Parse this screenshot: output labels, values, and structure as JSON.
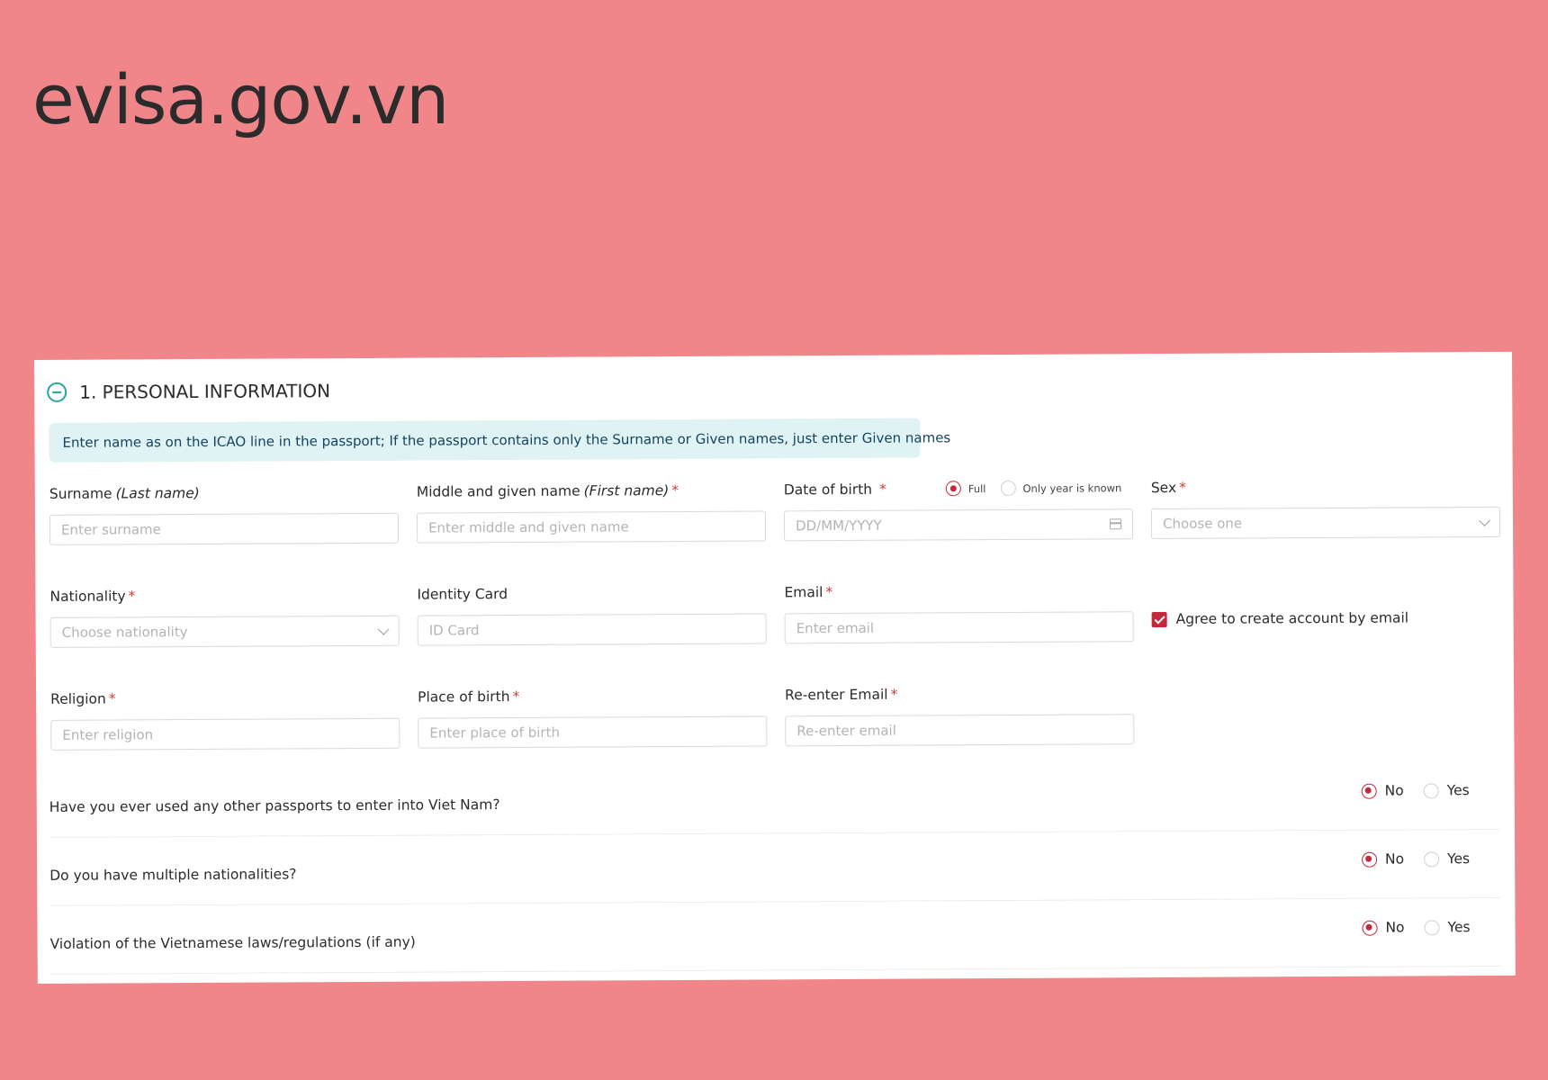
{
  "site_title": "evisa.gov.vn",
  "section": {
    "title": "1. PERSONAL INFORMATION",
    "notice": "Enter name as on the ICAO line in the passport; If the passport contains only the Surname or Given names, just enter Given names"
  },
  "fields": {
    "surname": {
      "label": "Surname",
      "label_em": "(Last name)",
      "placeholder": "Enter surname"
    },
    "given_name": {
      "label": "Middle and given name",
      "label_em": "(First name)",
      "placeholder": "Enter middle and given name"
    },
    "dob": {
      "label": "Date of birth",
      "placeholder": "DD/MM/YYYY",
      "option_full": "Full",
      "option_year": "Only year is known"
    },
    "sex": {
      "label": "Sex",
      "placeholder": "Choose one"
    },
    "nationality": {
      "label": "Nationality",
      "placeholder": "Choose nationality"
    },
    "identity_card": {
      "label": "Identity Card",
      "placeholder": "ID Card"
    },
    "email": {
      "label": "Email",
      "placeholder": "Enter email"
    },
    "agree": {
      "label": "Agree to create account by email",
      "checked": true
    },
    "religion": {
      "label": "Religion",
      "placeholder": "Enter religion"
    },
    "place_of_birth": {
      "label": "Place of birth",
      "placeholder": "Enter place of birth"
    },
    "reenter_email": {
      "label": "Re-enter Email",
      "placeholder": "Re-enter email"
    }
  },
  "required_mark": "*",
  "questions": [
    {
      "text": "Have you ever used any other passports to enter into Viet Nam?",
      "no": "No",
      "yes": "Yes",
      "selected": "No"
    },
    {
      "text": "Do you have multiple nationalities?",
      "no": "No",
      "yes": "Yes",
      "selected": "No"
    },
    {
      "text": "Violation of the Vietnamese laws/regulations (if any)",
      "no": "No",
      "yes": "Yes",
      "selected": "No"
    }
  ],
  "colors": {
    "accent": "#c4283d",
    "teal": "#2aa3a0",
    "background": "#f0868a"
  }
}
